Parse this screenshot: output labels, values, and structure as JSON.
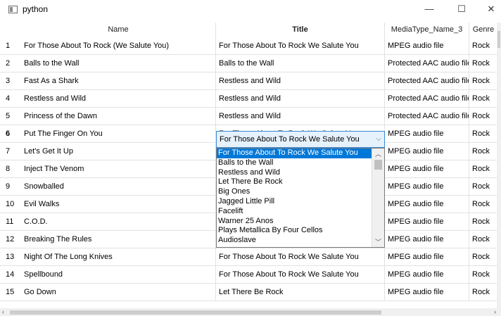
{
  "window": {
    "title": "python",
    "minimize": "—",
    "maximize": "☐",
    "close": "✕"
  },
  "columns": [
    "Name",
    "Title",
    "MediaType_Name_3",
    "Genre"
  ],
  "rows": [
    {
      "num": "1",
      "name": "For Those About To Rock (We Salute You)",
      "title": "For Those About To Rock We Salute You",
      "media": "MPEG audio file",
      "genre": "Rock"
    },
    {
      "num": "2",
      "name": "Balls to the Wall",
      "title": "Balls to the Wall",
      "media": "Protected AAC audio file",
      "genre": "Rock"
    },
    {
      "num": "3",
      "name": "Fast As a Shark",
      "title": "Restless and Wild",
      "media": "Protected AAC audio file",
      "genre": "Rock"
    },
    {
      "num": "4",
      "name": "Restless and Wild",
      "title": "Restless and Wild",
      "media": "Protected AAC audio file",
      "genre": "Rock"
    },
    {
      "num": "5",
      "name": "Princess of the Dawn",
      "title": "Restless and Wild",
      "media": "Protected AAC audio file",
      "genre": "Rock"
    },
    {
      "num": "6",
      "name": "Put The Finger On You",
      "title": "For Those About To Rock We Salute You",
      "media": "MPEG audio file",
      "genre": "Rock"
    },
    {
      "num": "7",
      "name": "Let's Get It Up",
      "title": "",
      "media": "MPEG audio file",
      "genre": "Rock"
    },
    {
      "num": "8",
      "name": "Inject The Venom",
      "title": "",
      "media": "MPEG audio file",
      "genre": "Rock"
    },
    {
      "num": "9",
      "name": "Snowballed",
      "title": "",
      "media": "MPEG audio file",
      "genre": "Rock"
    },
    {
      "num": "10",
      "name": "Evil Walks",
      "title": "",
      "media": "MPEG audio file",
      "genre": "Rock"
    },
    {
      "num": "11",
      "name": "C.O.D.",
      "title": "",
      "media": "MPEG audio file",
      "genre": "Rock"
    },
    {
      "num": "12",
      "name": "Breaking The Rules",
      "title": "",
      "media": "MPEG audio file",
      "genre": "Rock"
    },
    {
      "num": "13",
      "name": "Night Of The Long Knives",
      "title": "For Those About To Rock We Salute You",
      "media": "MPEG audio file",
      "genre": "Rock"
    },
    {
      "num": "14",
      "name": "Spellbound",
      "title": "For Those About To Rock We Salute You",
      "media": "MPEG audio file",
      "genre": "Rock"
    },
    {
      "num": "15",
      "name": "Go Down",
      "title": "Let There Be Rock",
      "media": "MPEG audio file",
      "genre": "Rock"
    }
  ],
  "combo": {
    "value": "For Those About To Rock We Salute You"
  },
  "dropdown_options": [
    "For Those About To Rock We Salute You",
    "Balls to the Wall",
    "Restless and Wild",
    "Let There Be Rock",
    "Big Ones",
    "Jagged Little Pill",
    "Facelift",
    "Warner 25 Anos",
    "Plays Metallica By Four Cellos",
    "Audioslave"
  ],
  "colors": {
    "selection": "#0078d7",
    "combo_bg": "#e5f1fb",
    "combo_border": "#3c8ad8"
  }
}
